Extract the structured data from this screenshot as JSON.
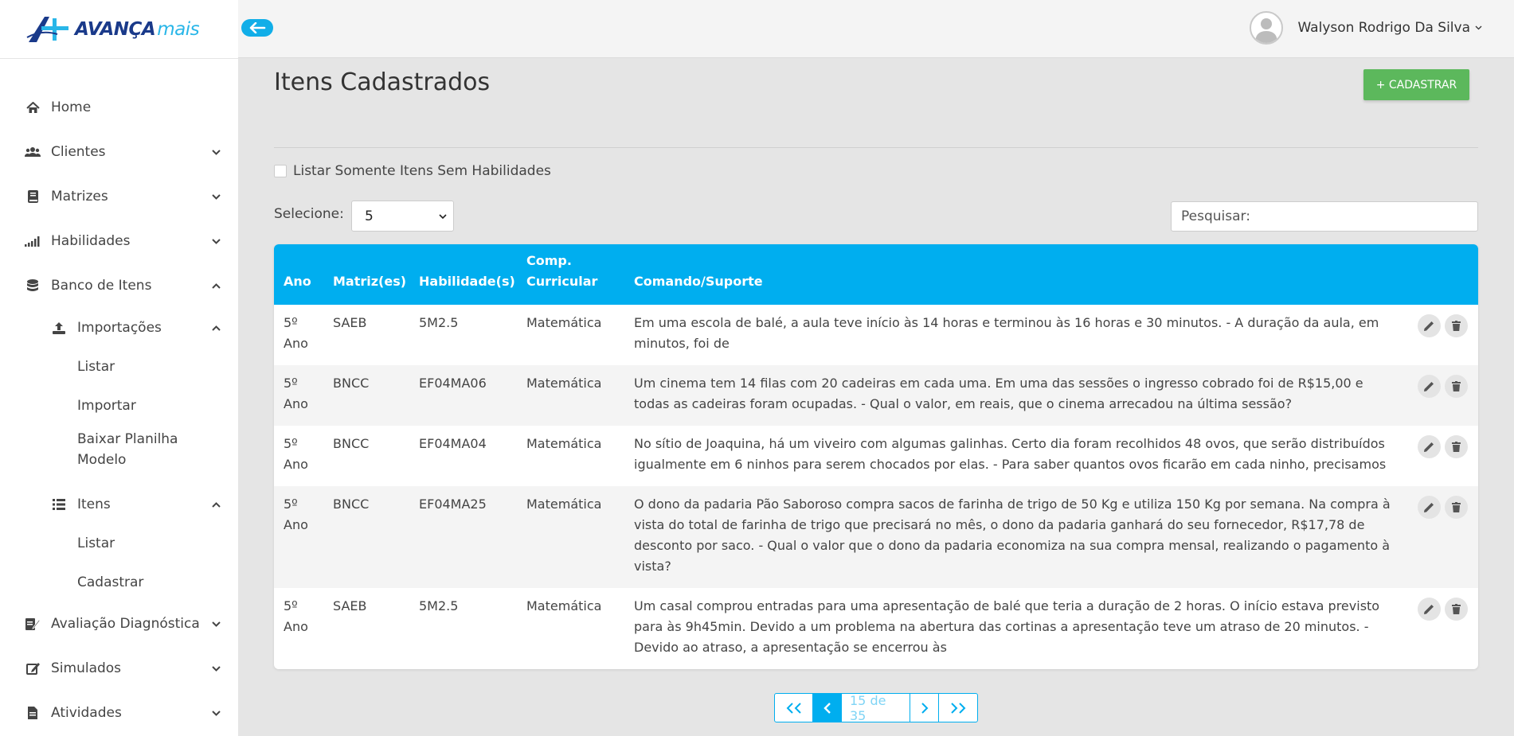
{
  "app": {
    "logo_text": "AVANÇA",
    "logo_text_accent": "mais"
  },
  "header": {
    "user_name": "Walyson Rodrigo Da Silva"
  },
  "sidebar": {
    "items": [
      {
        "label": "Home",
        "icon": "home-icon"
      },
      {
        "label": "Clientes",
        "icon": "users-icon"
      },
      {
        "label": "Matrizes",
        "icon": "book-icon"
      },
      {
        "label": "Habilidades",
        "icon": "signal-icon"
      },
      {
        "label": "Banco de Itens",
        "icon": "database-icon"
      },
      {
        "label": "Importações",
        "icon": "upload-icon"
      },
      {
        "label": "Listar"
      },
      {
        "label": "Importar"
      },
      {
        "label": "Baixar Planilha Modelo"
      },
      {
        "label": "Itens",
        "icon": "list-icon"
      },
      {
        "label": "Listar"
      },
      {
        "label": "Cadastrar"
      },
      {
        "label": "Avaliação Diagnóstica",
        "icon": "clipboard-icon"
      },
      {
        "label": "Simulados",
        "icon": "edit-icon"
      },
      {
        "label": "Atividades",
        "icon": "file-icon"
      }
    ]
  },
  "main": {
    "title": "Itens Cadastrados",
    "add_button": "+ CADASTRAR",
    "filter_checkbox_label": "Listar Somente Itens Sem Habilidades",
    "select_label": "Selecione:",
    "select_value": "5",
    "search_placeholder": "Pesquisar:"
  },
  "table": {
    "headers": {
      "ano": "Ano",
      "matriz": "Matriz(es)",
      "habilidade": "Habilidade(s)",
      "comp_line1": "Comp.",
      "comp_line2": "Curricular",
      "comando": "Comando/Suporte"
    },
    "rows": [
      {
        "ano": "5º Ano",
        "matriz": "SAEB",
        "habilidade": "5M2.5",
        "comp": "Matemática",
        "comando": "Em uma escola de balé, a aula teve início às 14 horas e terminou às 16 horas e 30 minutos. - A duração da aula, em minutos, foi de"
      },
      {
        "ano": "5º Ano",
        "matriz": "BNCC",
        "habilidade": "EF04MA06",
        "comp": "Matemática",
        "comando": "Um cinema tem 14 filas com 20 cadeiras em cada uma. Em uma das sessões o ingresso cobrado foi de R$15,00 e todas as cadeiras foram ocupadas. - Qual o valor, em reais, que o cinema arrecadou na última sessão?"
      },
      {
        "ano": "5º Ano",
        "matriz": "BNCC",
        "habilidade": "EF04MA04",
        "comp": "Matemática",
        "comando": "No sítio de Joaquina, há um viveiro com algumas galinhas. Certo dia foram recolhidos 48 ovos, que serão distribuídos igualmente em 6 ninhos para serem chocados por elas. - Para saber quantos ovos ficarão em cada ninho, precisamos"
      },
      {
        "ano": "5º Ano",
        "matriz": "BNCC",
        "habilidade": "EF04MA25",
        "comp": "Matemática",
        "comando": "O dono da padaria Pão Saboroso compra sacos de farinha de trigo de 50 Kg e utiliza 150 Kg por semana. Na compra à vista do total de farinha de trigo que precisará no mês, o dono da padaria ganhará do seu fornecedor, R$17,78 de desconto por saco. - Qual o valor que o dono da padaria economiza na sua compra mensal, realizando o pagamento à vista?"
      },
      {
        "ano": "5º Ano",
        "matriz": "SAEB",
        "habilidade": "5M2.5",
        "comp": "Matemática",
        "comando": "Um casal comprou entradas para uma apresentação de balé que teria a duração de 2 horas. O início estava previsto para às 9h45min. Devido a um problema na abertura das cortinas a apresentação teve um atraso de 20 minutos. - Devido ao atraso, a apresentação se encerrou às"
      }
    ]
  },
  "pagination": {
    "info": "15 de 35"
  },
  "colors": {
    "primary": "#00aeef",
    "success": "#5cb85c"
  }
}
